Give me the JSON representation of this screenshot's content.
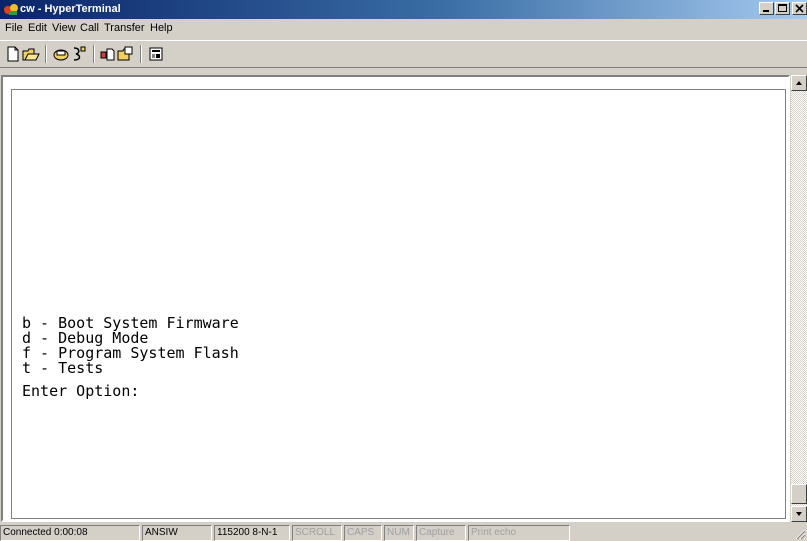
{
  "window": {
    "title": "cw - HyperTerminal",
    "controls": [
      "minimize",
      "maximize",
      "close"
    ]
  },
  "menu": [
    {
      "label": "File"
    },
    {
      "label": "Edit"
    },
    {
      "label": "View"
    },
    {
      "label": "Call"
    },
    {
      "label": "Transfer"
    },
    {
      "label": "Help"
    }
  ],
  "toolbar": {
    "icons": [
      "new-icon",
      "open-icon",
      "connect-icon",
      "disconnect-icon",
      "send-icon",
      "receive-icon",
      "properties-icon"
    ]
  },
  "terminal": {
    "lines": [
      "b - Boot System Firmware",
      "d - Debug Mode",
      "f - Program System Flash",
      "t - Tests",
      "",
      "Enter Option:"
    ]
  },
  "status": {
    "connected": "Connected 0:00:08",
    "emulation": "ANSIW",
    "settings": "115200 8-N-1",
    "scroll": "SCROLL",
    "caps": "CAPS",
    "num": "NUM",
    "capture": "Capture",
    "print_echo": "Print echo"
  },
  "colors": {
    "title_start": "#0a246a",
    "title_end": "#a6caf0",
    "chrome": "#d4d0c8",
    "terminal_bg": "#ffffff"
  }
}
